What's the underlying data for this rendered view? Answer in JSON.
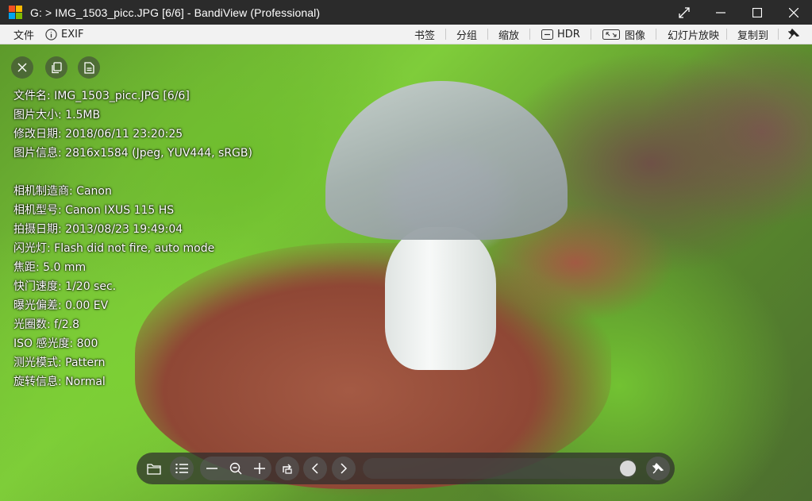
{
  "window": {
    "title": "G: > IMG_1503_picc.JPG [6/6] - BandiView (Professional)",
    "controls": [
      "fullscreen-icon",
      "minimize-icon",
      "maximize-icon",
      "close-icon"
    ]
  },
  "menubar": {
    "file": "文件",
    "exif": "EXIF",
    "bookmarks": "书签",
    "group": "分组",
    "zoom": "缩放",
    "hdr": "HDR",
    "image": "图像",
    "slideshow": "幻灯片放映",
    "copy_to": "复制到"
  },
  "overlay_buttons": [
    "close-icon",
    "copy-icon",
    "document-icon"
  ],
  "info": {
    "filename": "文件名: IMG_1503_picc.JPG [6/6]",
    "filesize": "图片大小: 1.5MB",
    "modified": "修改日期: 2018/06/11 23:20:25",
    "imageinfo": "图片信息: 2816x1584 (Jpeg, YUV444, sRGB)",
    "maker": "相机制造商: Canon",
    "model": "相机型号: Canon IXUS 115 HS",
    "taken": "拍摄日期: 2013/08/23 19:49:04",
    "flash": "闪光灯: Flash did not fire, auto mode",
    "focal": "焦距: 5.0 mm",
    "shutter": "快门速度: 1/20 sec.",
    "exposure_bias": "曝光偏差: 0.00 EV",
    "aperture": "光圈数: f/2.8",
    "iso": "ISO 感光度: 800",
    "metering": "测光模式: Pattern",
    "orientation": "旋转信息: Normal"
  },
  "toolbar": {
    "buttons": [
      "folder-icon",
      "list-icon",
      "zoom-out-icon",
      "zoom-fit-icon",
      "zoom-in-icon",
      "rotate-icon",
      "prev-icon",
      "next-icon",
      "pin-icon"
    ],
    "slider_position": 1.0
  }
}
